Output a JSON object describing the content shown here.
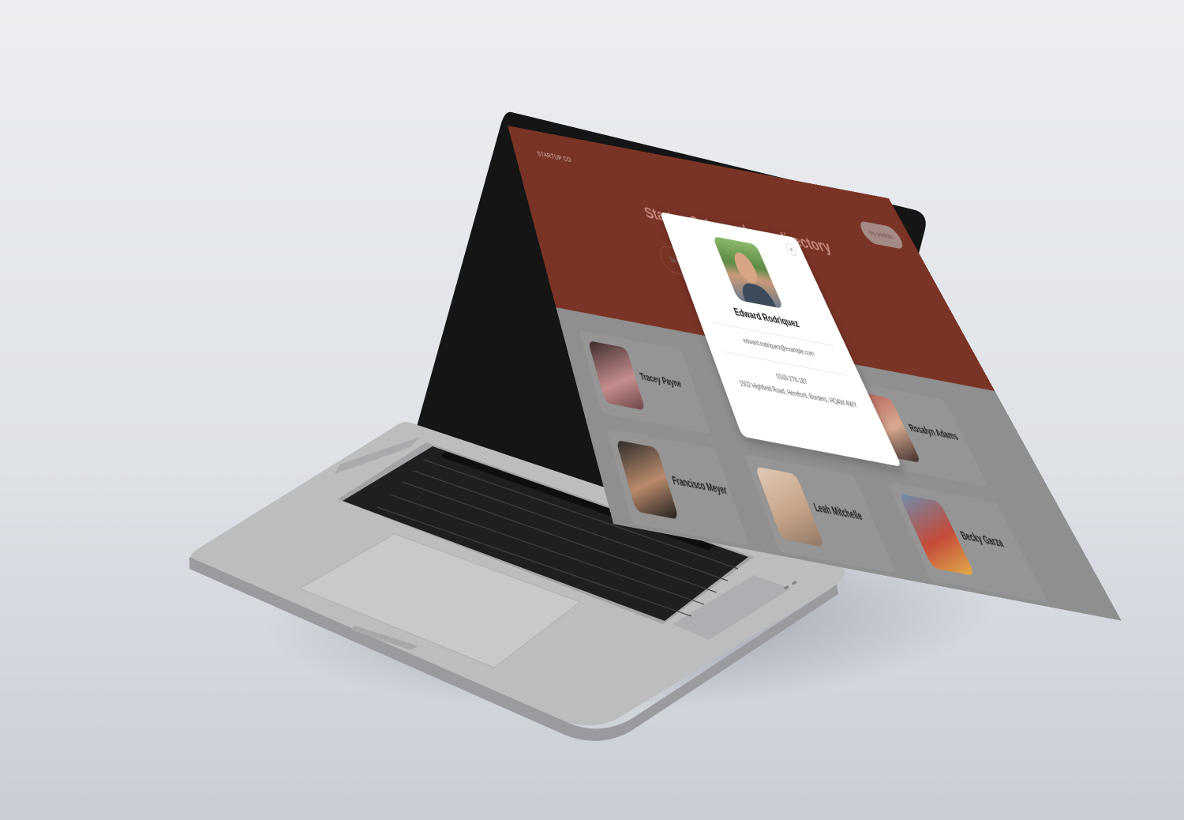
{
  "header": {
    "brand": "STARTUP CO",
    "portfolio_button": "My portfolio",
    "title": "Startup Co's employee directory",
    "subtitle": "",
    "search_placeholder": "Search"
  },
  "employees": [
    {
      "name": "Tracey Payne",
      "role": ""
    },
    {
      "name": "Francisco Meyer",
      "role": ""
    },
    {
      "name": "Leah Mitchelle",
      "role": ""
    },
    {
      "name": "Rosalyn Adams",
      "role": ""
    },
    {
      "name": "Becky Garza",
      "role": ""
    }
  ],
  "modal": {
    "name": "Edward Rodriquez",
    "email": "edward.rodriquez@example.com",
    "phone": "0169-278-187",
    "address": "1502 Highfield Road, Hereford, Borders, HQ4W 4WY",
    "close_icon": "close-icon"
  },
  "colors": {
    "hero": "#7a3426",
    "page_dim": "#8f8f8f",
    "modal_bg": "#ffffff"
  }
}
